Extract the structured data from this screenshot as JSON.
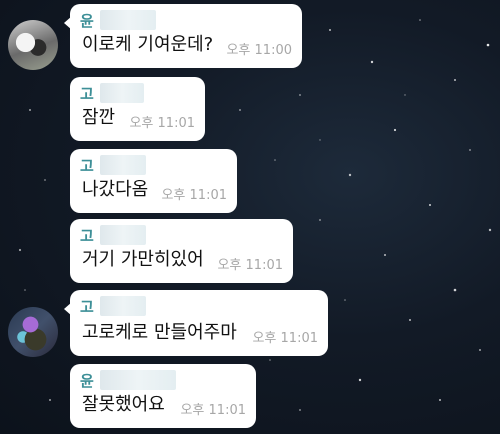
{
  "messages": [
    {
      "sender": "윤",
      "text": "이로케 기여운데?",
      "time": "오후 11:00"
    },
    {
      "sender": "고",
      "text": "잠깐",
      "time": "오후 11:01"
    },
    {
      "sender": "고",
      "text": "나갔다옴",
      "time": "오후 11:01"
    },
    {
      "sender": "고",
      "text": "거기 가만히있어",
      "time": "오후 11:01"
    },
    {
      "sender": "고",
      "text": "고로케로 만들어주마",
      "time": "오후 11:01"
    },
    {
      "sender": "윤",
      "text": "잘못했어요",
      "time": "오후 11:01"
    }
  ]
}
